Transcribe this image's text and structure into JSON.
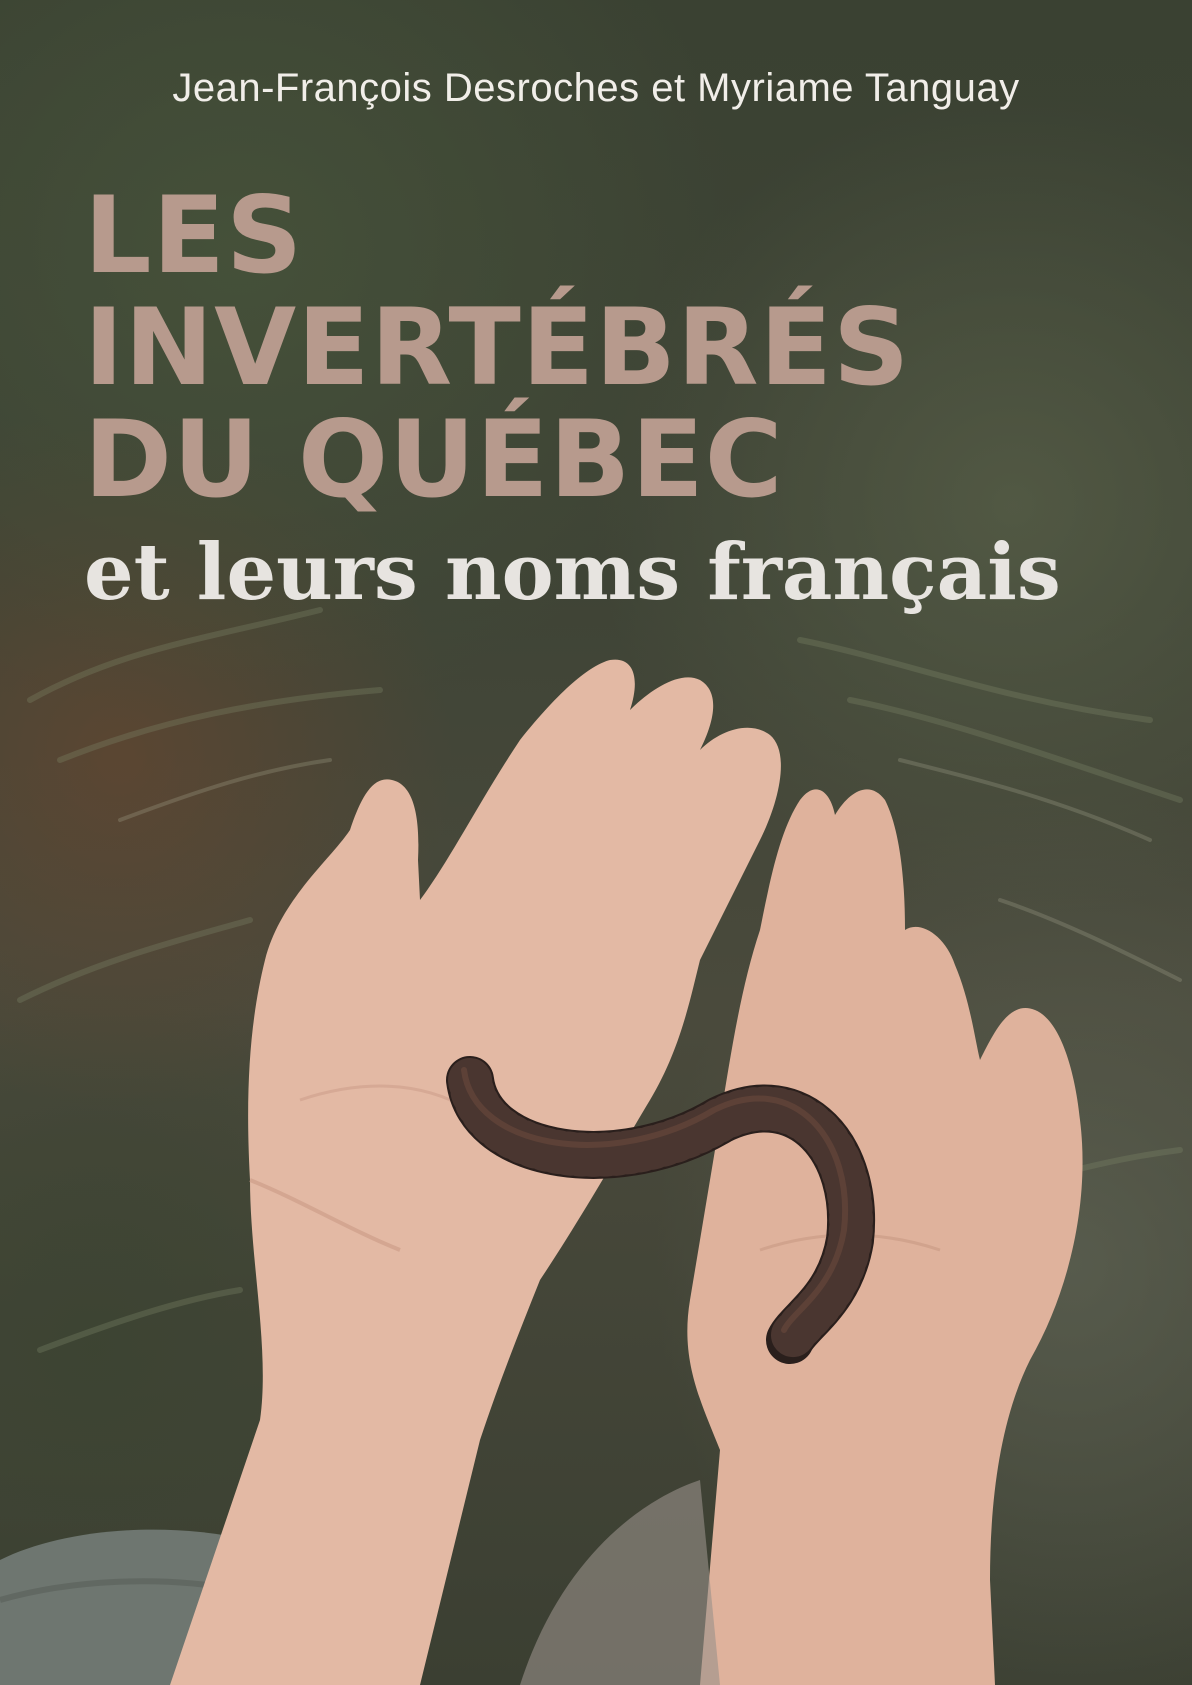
{
  "cover": {
    "authors": "Jean-François Desroches et Myriame Tanguay",
    "title_lines": [
      "LES",
      "INVERTÉBRÉS",
      "DU QUÉBEC"
    ],
    "subtitle": "et leurs noms français"
  },
  "colors": {
    "title": "#b79a8d",
    "subtitle": "#e7e4e0",
    "authors": "#f1eee9",
    "background": "#3f4436",
    "millipede": "#2a1f1c"
  }
}
